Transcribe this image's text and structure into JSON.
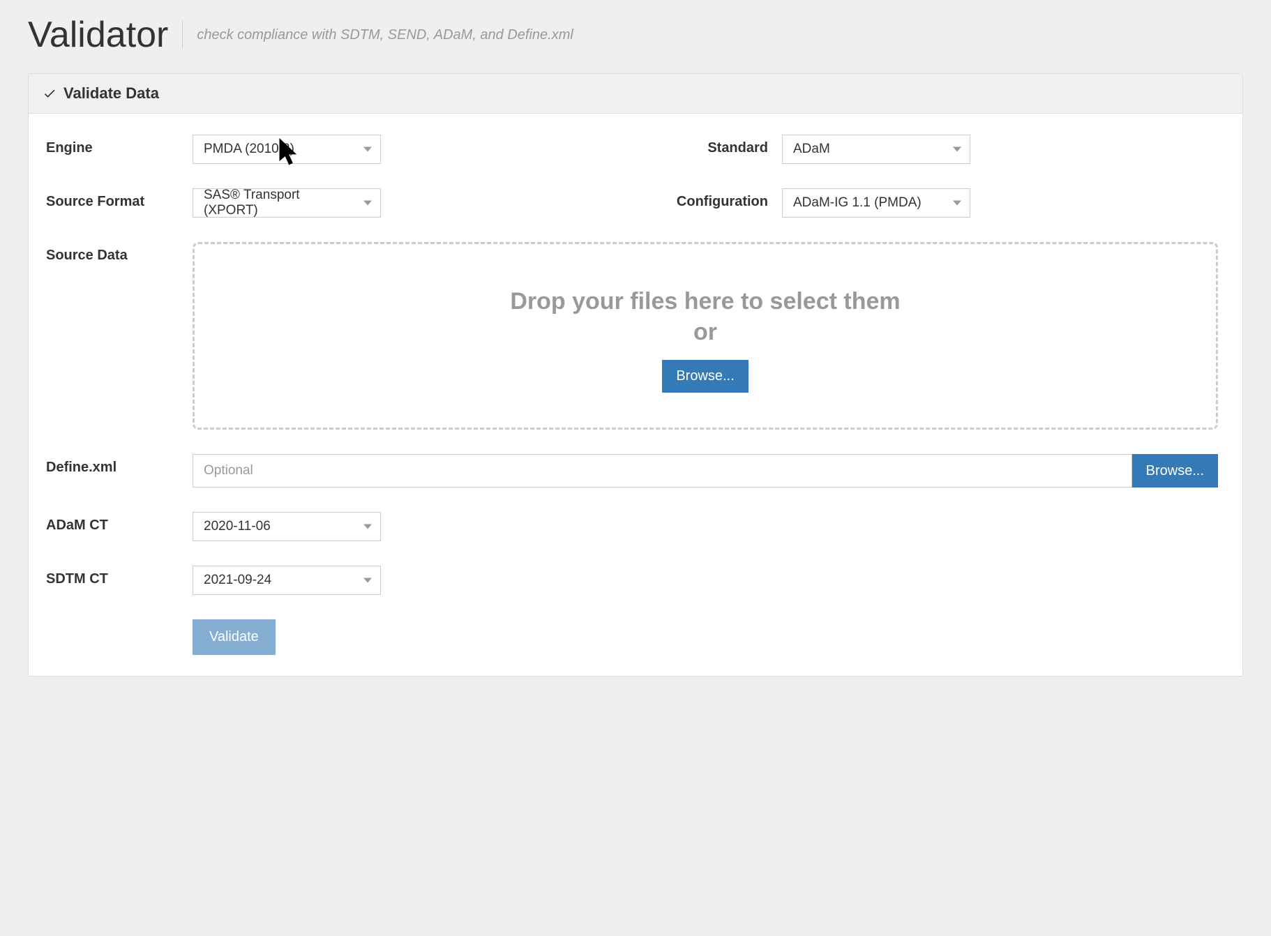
{
  "header": {
    "title": "Validator",
    "subtitle": "check compliance with SDTM, SEND, ADaM, and Define.xml"
  },
  "panel": {
    "title": "Validate Data"
  },
  "form": {
    "engine": {
      "label": "Engine",
      "value": "PMDA (2010.2)"
    },
    "standard": {
      "label": "Standard",
      "value": "ADaM"
    },
    "source_format": {
      "label": "Source Format",
      "value": "SAS® Transport (XPORT)"
    },
    "configuration": {
      "label": "Configuration",
      "value": "ADaM-IG 1.1 (PMDA)"
    },
    "source_data": {
      "label": "Source Data",
      "drop_text_line1": "Drop your files here to select them",
      "drop_text_line2": "or",
      "browse_label": "Browse..."
    },
    "define_xml": {
      "label": "Define.xml",
      "placeholder": "Optional",
      "browse_label": "Browse..."
    },
    "adam_ct": {
      "label": "ADaM CT",
      "value": "2020-11-06"
    },
    "sdtm_ct": {
      "label": "SDTM CT",
      "value": "2021-09-24"
    },
    "validate_button": "Validate"
  }
}
